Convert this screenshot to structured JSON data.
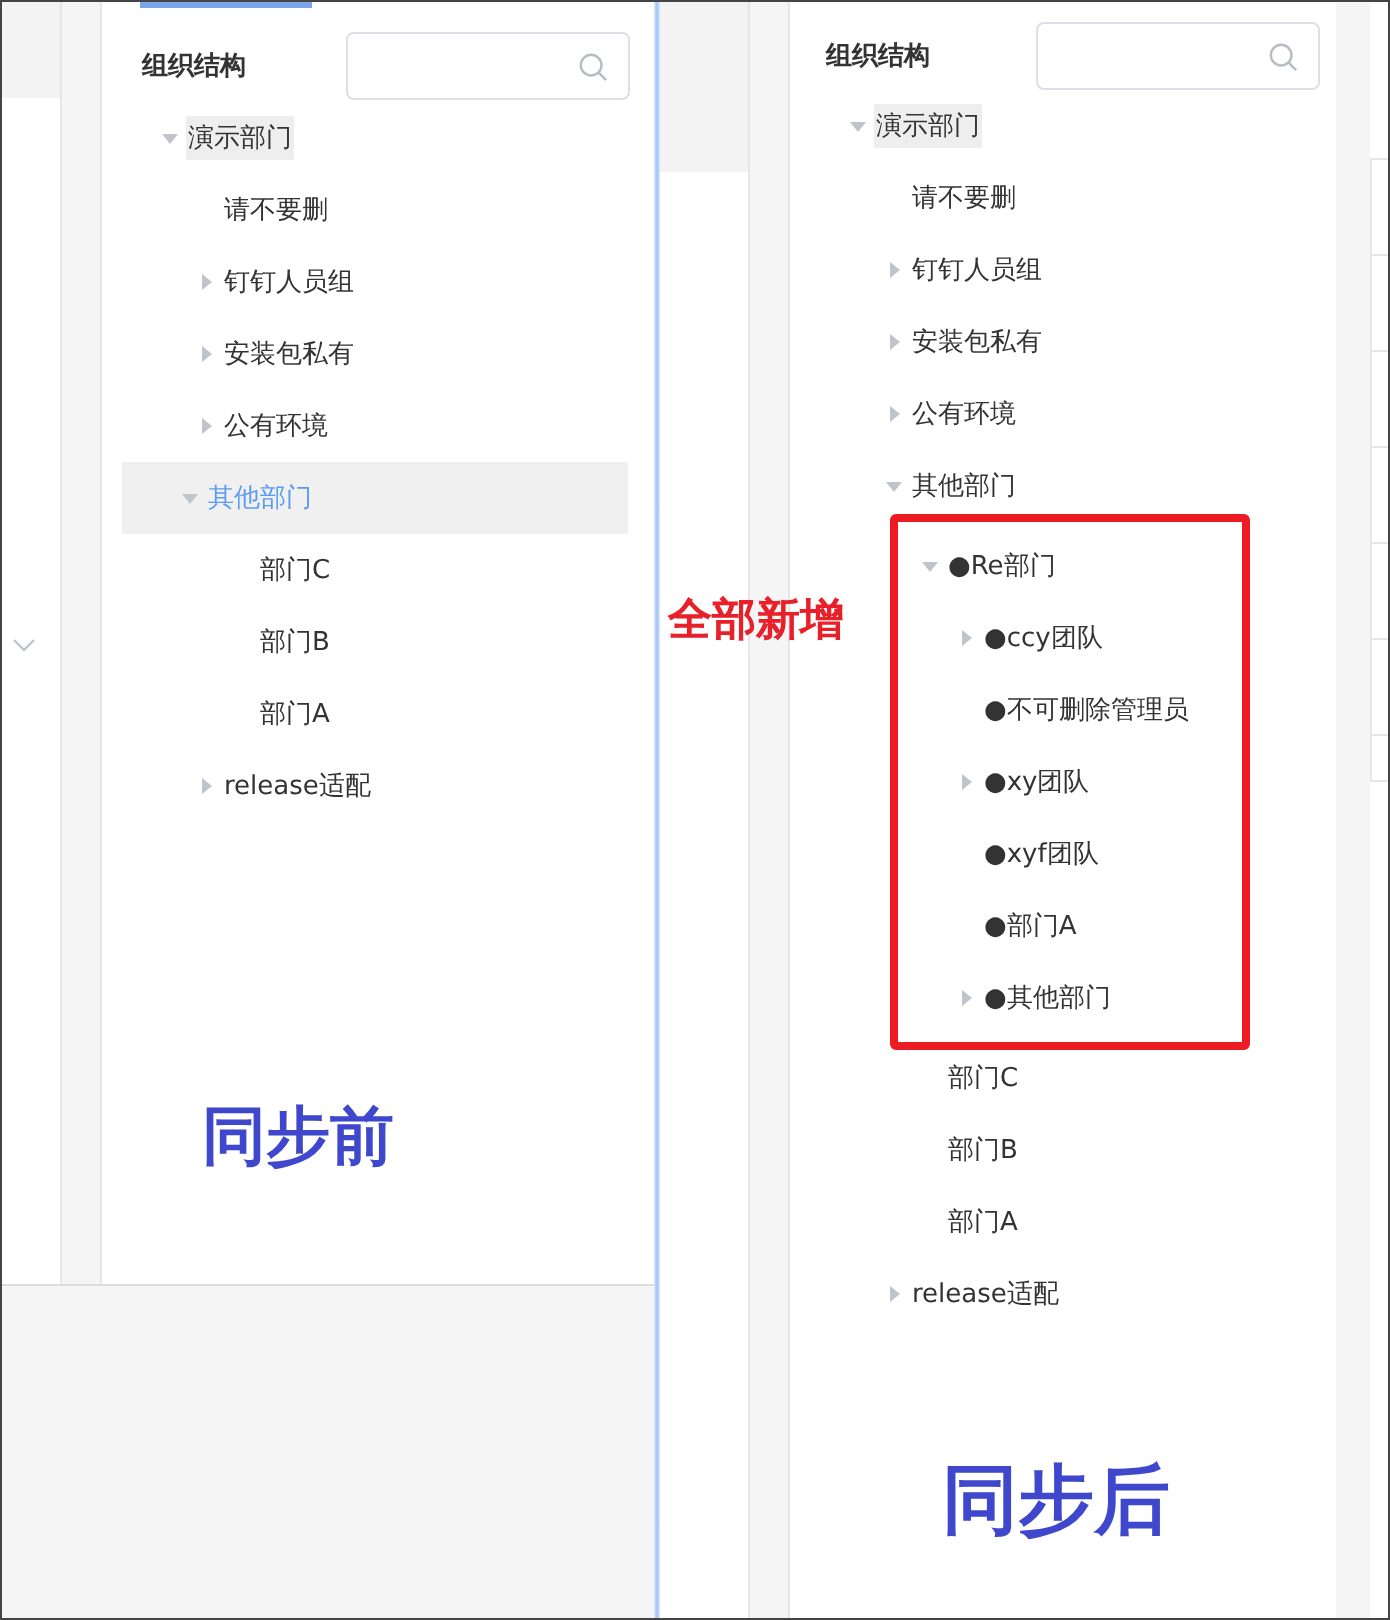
{
  "before": {
    "title": "组织结构",
    "tree": [
      {
        "label": "演示部门",
        "expanded": true,
        "current": true,
        "selected": false,
        "children": [
          {
            "label": "请不要删",
            "selected": false
          },
          {
            "label": "钉钉人员组",
            "expanded": false,
            "selected": false
          },
          {
            "label": "安装包私有",
            "expanded": false,
            "selected": false
          },
          {
            "label": "公有环境",
            "expanded": false,
            "selected": false
          },
          {
            "label": "其他部门",
            "expanded": true,
            "selected": true,
            "children": [
              {
                "label": "部门C",
                "selected": false
              },
              {
                "label": "部门B",
                "selected": false
              },
              {
                "label": "部门A",
                "selected": false
              }
            ]
          },
          {
            "label": "release适配",
            "expanded": false,
            "selected": false
          }
        ]
      }
    ],
    "caption": "同步前"
  },
  "after": {
    "title": "组织结构",
    "tree": [
      {
        "label": "演示部门",
        "expanded": true,
        "current": true,
        "selected": false,
        "children": [
          {
            "label": "请不要删",
            "selected": false
          },
          {
            "label": "钉钉人员组",
            "expanded": false,
            "selected": false
          },
          {
            "label": "安装包私有",
            "expanded": false,
            "selected": false
          },
          {
            "label": "公有环境",
            "expanded": false,
            "selected": false
          },
          {
            "label": "其他部门",
            "expanded": true,
            "selected": false,
            "children": [
              {
                "label": "●Re部门",
                "expanded": true,
                "selected": false,
                "new": true,
                "children": [
                  {
                    "label": "●ccy团队",
                    "expanded": false,
                    "selected": false
                  },
                  {
                    "label": "●不可删除管理员",
                    "selected": false
                  },
                  {
                    "label": "●xy团队",
                    "expanded": false,
                    "selected": false
                  },
                  {
                    "label": "●xyf团队",
                    "selected": false
                  },
                  {
                    "label": "●部门A",
                    "selected": false
                  },
                  {
                    "label": "●其他部门",
                    "expanded": false,
                    "selected": false
                  }
                ]
              },
              {
                "label": "部门C",
                "selected": false,
                "new": false
              },
              {
                "label": "部门B",
                "selected": false,
                "new": false
              },
              {
                "label": "部门A",
                "selected": false,
                "new": false
              }
            ]
          },
          {
            "label": "release适配",
            "expanded": false,
            "selected": false
          }
        ]
      }
    ],
    "annotation": "全部新增",
    "caption": "同步后"
  }
}
